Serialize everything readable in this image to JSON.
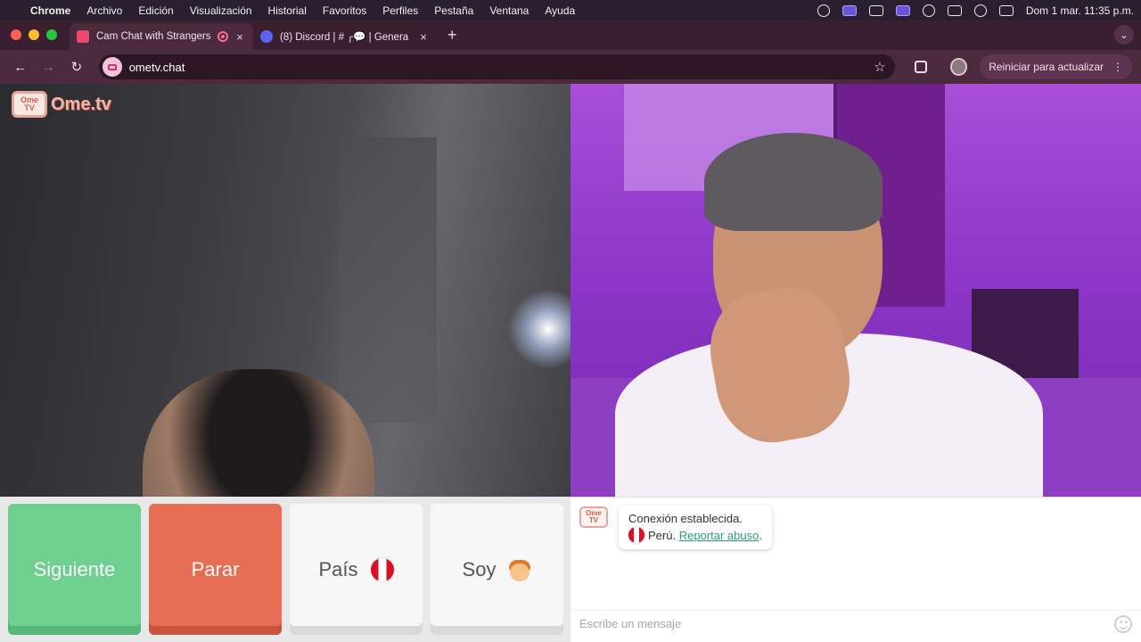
{
  "menubar": {
    "app_name": "Chrome",
    "items": [
      "Archivo",
      "Edición",
      "Visualización",
      "Historial",
      "Favoritos",
      "Perfiles",
      "Pestaña",
      "Ventana",
      "Ayuda"
    ],
    "datetime": "Dom 1 mar.  11:35 p.m."
  },
  "tabs": [
    {
      "title": "Cam Chat with Strangers",
      "active": true,
      "favicon": "ometv-icon"
    },
    {
      "title": "(8) Discord | # ╭💬 | Genera",
      "active": false,
      "favicon": "discord-icon"
    }
  ],
  "toolbar": {
    "url": "ometv.chat",
    "update_label": "Reiniciar para actualizar"
  },
  "video": {
    "logo_badge_top": "Ome",
    "logo_badge_bottom": "TV",
    "logo_text": "Ome.tv"
  },
  "controls": {
    "next_label": "Siguiente",
    "stop_label": "Parar",
    "country_label": "País",
    "gender_label": "Soy"
  },
  "chat": {
    "status_text": "Conexión establecida.",
    "country_text": "Perú.",
    "report_link": "Reportar abuso",
    "report_suffix": ".",
    "input_placeholder": "Escribe un mensaje"
  },
  "colors": {
    "next": "#6fcf8e",
    "stop": "#e56e55",
    "link": "#2b9d7b",
    "chrome_toolbar": "#4b2a3e"
  }
}
